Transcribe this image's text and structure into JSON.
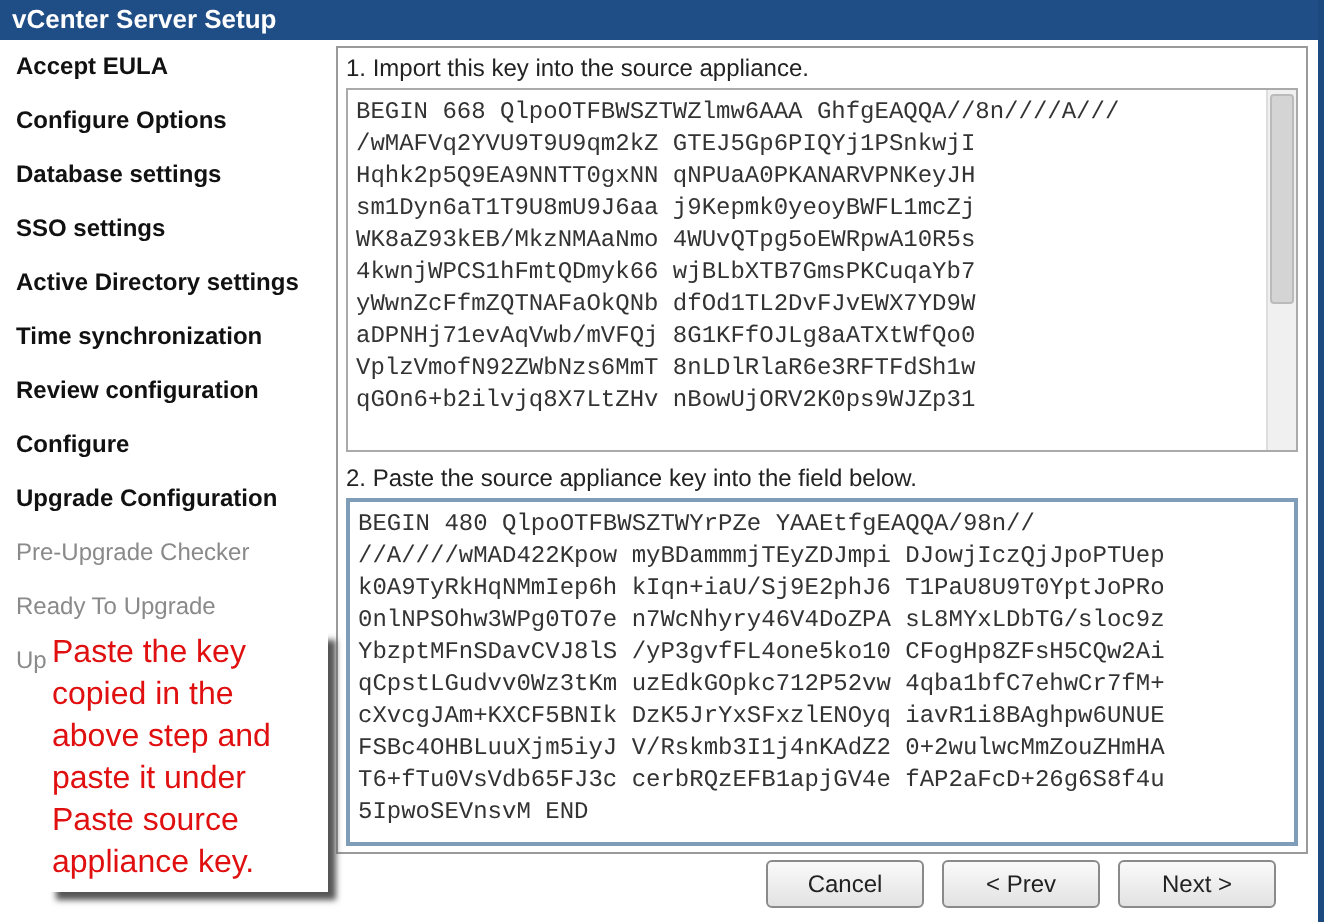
{
  "window": {
    "title": "vCenter Server Setup"
  },
  "sidebar": {
    "items": [
      {
        "label": "Accept EULA",
        "disabled": false
      },
      {
        "label": "Configure Options",
        "disabled": false
      },
      {
        "label": "Database settings",
        "disabled": false
      },
      {
        "label": "SSO settings",
        "disabled": false
      },
      {
        "label": "Active Directory settings",
        "disabled": false
      },
      {
        "label": "Time synchronization",
        "disabled": false
      },
      {
        "label": "Review configuration",
        "disabled": false
      },
      {
        "label": "Configure",
        "disabled": false
      },
      {
        "label": "Upgrade Configuration",
        "disabled": false
      },
      {
        "label": "Pre-Upgrade Checker",
        "disabled": true
      },
      {
        "label": "Ready To Upgrade",
        "disabled": true
      },
      {
        "label": "Up",
        "disabled": true
      }
    ]
  },
  "step1": {
    "label": "1. Import this key into the source appliance.",
    "key_lines": [
      "BEGIN 668 QlpoOTFBWSZTWZlmw6AAA GhfgEAQQA//8n////A///",
      "/wMAFVq2YVU9T9U9qm2kZ GTEJ5Gp6PIQYj1PSnkwjI",
      "Hqhk2p5Q9EA9NNTT0gxNN qNPUaA0PKANARVPNKeyJH",
      "sm1Dyn6aT1T9U8mU9J6aa j9Kepmk0yeoyBWFL1mcZj",
      "WK8aZ93kEB/MkzNMAaNmo 4WUvQTpg5oEWRpwA10R5s",
      "4kwnjWPCS1hFmtQDmyk66 wjBLbXTB7GmsPKCuqaYb7",
      "yWwnZcFfmZQTNAFaOkQNb dfOd1TL2DvFJvEWX7YD9W",
      "aDPNHj71evAqVwb/mVFQj 8G1KFfOJLg8aATXtWfQo0",
      "VplzVmofN92ZWbNzs6MmT 8nLDlRlaR6e3RFTFdSh1w",
      "qGOn6+b2ilvjq8X7LtZHv nBowUjORV2K0ps9WJZp31"
    ]
  },
  "step2": {
    "label": "2. Paste the source appliance key into the field below.",
    "key_lines": [
      "BEGIN 480 QlpoOTFBWSZTWYrPZe YAAEtfgEAQQA/98n//",
      "//A////wMAD422Kpow myBDammmjTEyZDJmpi DJowjIczQjJpoPTUep",
      "k0A9TyRkHqNMmIep6h kIqn+iaU/Sj9E2phJ6 T1PaU8U9T0YptJoPRo",
      "0nlNPSOhw3WPg0TO7e n7WcNhyry46V4DoZPA sL8MYxLDbTG/sloc9z",
      "YbzptMFnSDavCVJ8lS /yP3gvfFL4one5ko10 CFogHp8ZFsH5CQw2Ai",
      "qCpstLGudvv0Wz3tKm uzEdkGOpkc712P52vw 4qba1bfC7ehwCr7fM+",
      "cXvcgJAm+KXCF5BNIk DzK5JrYxSFxzlENOyq iavR1i8BAghpw6UNUE",
      "FSBc4OHBLuuXjm5iyJ V/Rskmb3I1j4nKAdZ2 0+2wulwcMmZouZHmHA",
      "T6+fTu0VsVdb65FJ3c cerbRQzEFB1apjGV4e fAP2aFcD+26g6S8f4u",
      "5IpwoSEVnsvM END"
    ]
  },
  "callout": {
    "text": "Paste the key copied in the above step and paste it under Paste source appliance key."
  },
  "buttons": [
    {
      "label": "Cancel"
    },
    {
      "label": "< Prev"
    },
    {
      "label": "Next >"
    }
  ]
}
